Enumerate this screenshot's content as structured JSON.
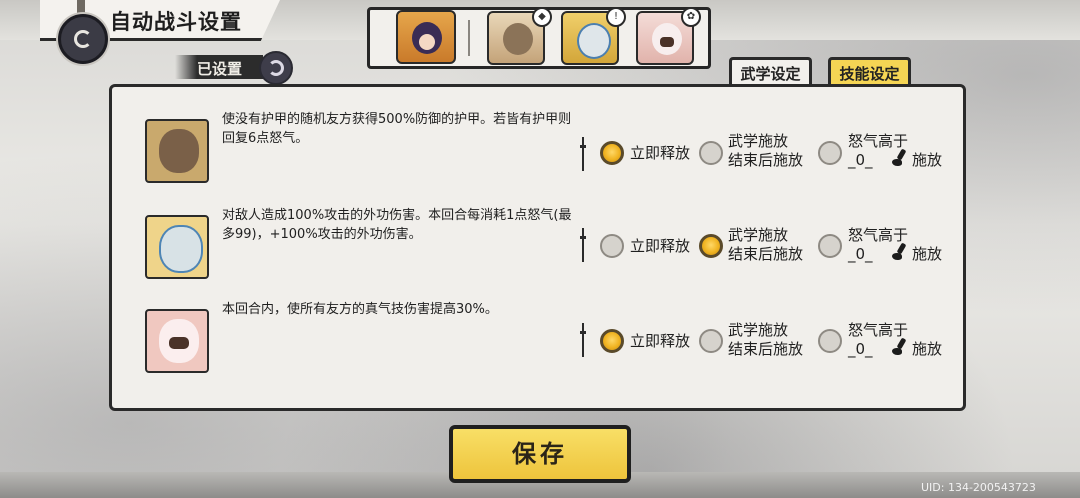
{
  "header": {
    "title": "自动战斗设置",
    "back_icon": "back-emblem-icon"
  },
  "status": {
    "label": "已设置",
    "icon": "swirl-icon"
  },
  "team": {
    "portraits": [
      "leader",
      "member-1",
      "member-2",
      "member-3"
    ],
    "badges": [
      "◆",
      "!",
      "✿"
    ]
  },
  "tabs": [
    {
      "label": "武学设定",
      "active": false
    },
    {
      "label": "技能设定",
      "active": true
    }
  ],
  "skills": [
    {
      "description": "使没有护甲的随机友方获得500%防御的护甲。若皆有护甲则回复6点怒气。",
      "options": {
        "immediate": "立即释放",
        "after_line1": "武学施放",
        "after_line2": "结束后施放",
        "rage_line1": "怒气高于",
        "rage_value": "_0_",
        "rage_suffix": "施放"
      },
      "selected": "immediate"
    },
    {
      "description": "对敌人造成100%攻击的外功伤害。本回合每消耗1点怒气(最多99)，+100%攻击的外功伤害。",
      "options": {
        "immediate": "立即释放",
        "after_line1": "武学施放",
        "after_line2": "结束后施放",
        "rage_line1": "怒气高于",
        "rage_value": "_0_",
        "rage_suffix": "施放"
      },
      "selected": "after"
    },
    {
      "description": "本回合内，使所有友方的真气技伤害提高30%。",
      "options": {
        "immediate": "立即释放",
        "after_line1": "武学施放",
        "after_line2": "结束后施放",
        "rage_line1": "怒气高于",
        "rage_value": "_0_",
        "rage_suffix": "施放"
      },
      "selected": "immediate"
    }
  ],
  "save_label": "保存",
  "uid": "UID: 134-200543723",
  "colors": {
    "accent": "#f5d554",
    "panel": "#f1efeb",
    "border": "#2a2a2a"
  }
}
